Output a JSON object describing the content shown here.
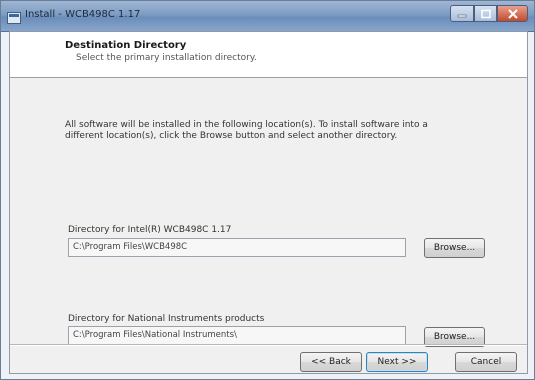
{
  "window": {
    "title": "Install - WCB498C 1.17"
  },
  "header": {
    "title": "Destination Directory",
    "subtitle": "Select the primary installation directory."
  },
  "instructions": "All software will be installed in the following location(s). To install software into a different location(s), click the Browse button and select another directory.",
  "primary_dir": {
    "label": "Directory for Intel(R) WCB498C 1.17",
    "path": "C:\\Program Files\\WCB498C",
    "browse_label": "Browse..."
  },
  "shared_dir": {
    "label": "Directory for National Instruments products",
    "path": "C:\\Program Files\\National Instruments\\",
    "browse_label": "Browse..."
  },
  "footer": {
    "back_label": "<< Back",
    "next_label": "Next >>",
    "cancel_label": "Cancel"
  },
  "icons": {
    "app": "installer-app-icon",
    "minimize": "minimize-icon",
    "maximize": "maximize-icon",
    "close": "close-icon"
  }
}
